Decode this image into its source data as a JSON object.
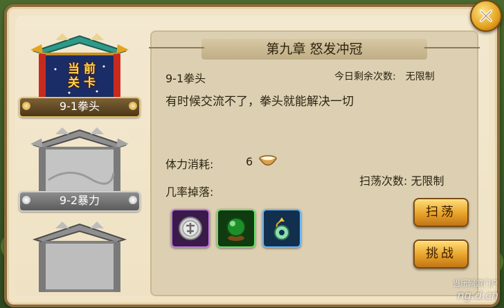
{
  "stages": [
    {
      "gate_line1": "当 前",
      "gate_line2": "关 卡",
      "label": "9-1拳头",
      "current": true
    },
    {
      "label": "9-2暴力",
      "current": false
    },
    {
      "label": "",
      "current": false
    }
  ],
  "detail": {
    "chapter_title": "第九章 怒发冲冠",
    "stage_name": "9-1拳头",
    "daily_label": "今日剩余次数:",
    "daily_value": "无限制",
    "description": "有时候交流不了，拳头就能解决一切",
    "stamina_label": "体力消耗:",
    "stamina_value": "6",
    "drops_label": "几率掉落:",
    "sweep_count": "扫荡次数: 无限制"
  },
  "buttons": {
    "sweep": "扫荡",
    "challenge": "挑战"
  },
  "drops": [
    {
      "icon": "silver-seal-icon",
      "frame": "purple"
    },
    {
      "icon": "green-orb-icon",
      "frame": "green"
    },
    {
      "icon": "jade-pendant-icon",
      "frame": "blue"
    }
  ],
  "watermark": {
    "line1": "当乐网游门户",
    "line2": "ng.d.cn"
  },
  "colors": {
    "accent_gold": "#e8a22a",
    "panel": "#ddd0b2",
    "frame": "#f0e3c6"
  }
}
